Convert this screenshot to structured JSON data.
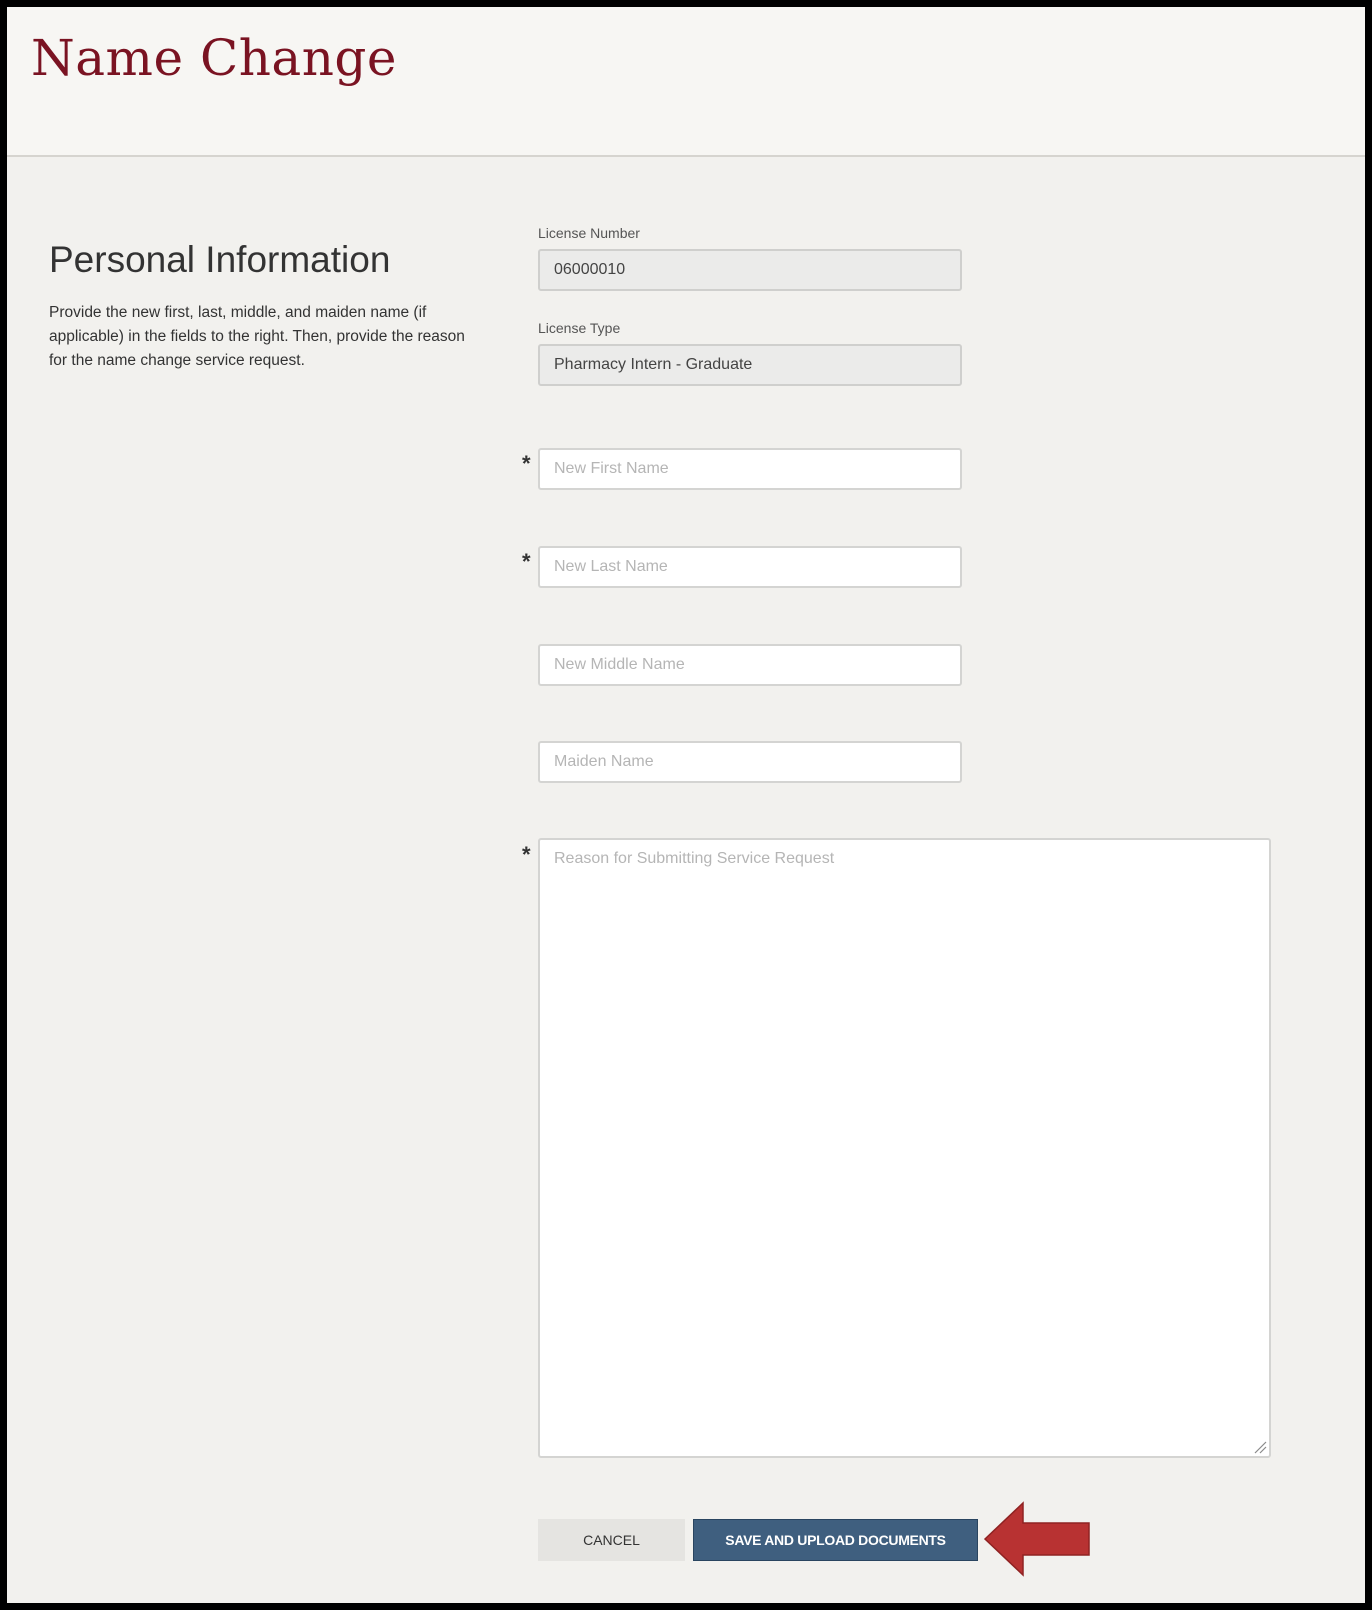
{
  "header": {
    "title": "Name Change"
  },
  "section": {
    "title": "Personal Information",
    "description": "Provide the new first, last, middle, and maiden name (if applicable) in the fields to the right. Then, provide the reason for the name change service request."
  },
  "license": {
    "number_label": "License Number",
    "number_value": "06000010",
    "type_label": "License Type",
    "type_value": "Pharmacy Intern - Graduate"
  },
  "fields": {
    "required_marker": "*",
    "first_name_placeholder": "New First Name",
    "last_name_placeholder": "New Last Name",
    "middle_name_placeholder": "New Middle Name",
    "maiden_name_placeholder": "Maiden Name",
    "reason_placeholder": "Reason for Submitting Service Request"
  },
  "actions": {
    "cancel_label": "CANCEL",
    "save_label": "SAVE AND UPLOAD DOCUMENTS"
  },
  "colors": {
    "title": "#7a1322",
    "save_button": "#3f5f7f",
    "annotation_arrow": "#b83232"
  }
}
